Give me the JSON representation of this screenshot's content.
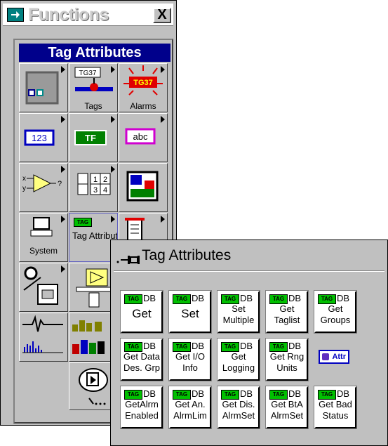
{
  "functions_window": {
    "title": "Functions",
    "close_label": "X",
    "header": "Tag Attributes",
    "palette": [
      {
        "name": "structures",
        "label": ""
      },
      {
        "name": "tags",
        "label": "Tags",
        "badge": "TG37"
      },
      {
        "name": "alarms",
        "label": "Alarms",
        "badge": "TG37"
      },
      {
        "name": "numeric",
        "label": "",
        "badge": "123"
      },
      {
        "name": "boolean",
        "label": "",
        "badge": "TF"
      },
      {
        "name": "string",
        "label": "",
        "badge": "abc"
      },
      {
        "name": "comparison",
        "label": ""
      },
      {
        "name": "array",
        "label": "",
        "badge": "1 2 3 4"
      },
      {
        "name": "cluster",
        "label": ""
      },
      {
        "name": "system",
        "label": "System"
      },
      {
        "name": "tag-attributes",
        "label": "Tag Attribut",
        "badge": "TAG"
      },
      {
        "name": "file",
        "label": ""
      },
      {
        "name": "time-dialog",
        "label": ""
      },
      {
        "name": "advanced",
        "label": ""
      },
      {
        "name": "instrument",
        "label": ""
      },
      {
        "name": "analysis",
        "label": ""
      },
      {
        "name": "graphics",
        "label": ""
      },
      {
        "name": "comms",
        "label": ""
      },
      {
        "name": "select-vi",
        "label": ""
      }
    ]
  },
  "tag_window": {
    "title": "Tag Attributes",
    "badge": "TAG",
    "db": "DB",
    "attr_label": "Attr",
    "buttons": [
      {
        "line1": "Get",
        "line2": ""
      },
      {
        "line1": "Set",
        "line2": ""
      },
      {
        "line1": "Set",
        "line2": "Multiple"
      },
      {
        "line1": "Get",
        "line2": "Taglist"
      },
      {
        "line1": "Get",
        "line2": "Groups"
      },
      {
        "line1": "Get Data",
        "line2": "Des. Grp"
      },
      {
        "line1": "Get I/O",
        "line2": "Info"
      },
      {
        "line1": "Get",
        "line2": "Logging"
      },
      {
        "line1": "Get Rng",
        "line2": "Units"
      },
      {
        "line1": "GetAlrm",
        "line2": "Enabled"
      },
      {
        "line1": "Get An.",
        "line2": "AlrmLim"
      },
      {
        "line1": "Get Dis.",
        "line2": "AlrmSet"
      },
      {
        "line1": "Get BtA",
        "line2": "AlrmSet"
      },
      {
        "line1": "Get Bad",
        "line2": "Status"
      }
    ]
  }
}
